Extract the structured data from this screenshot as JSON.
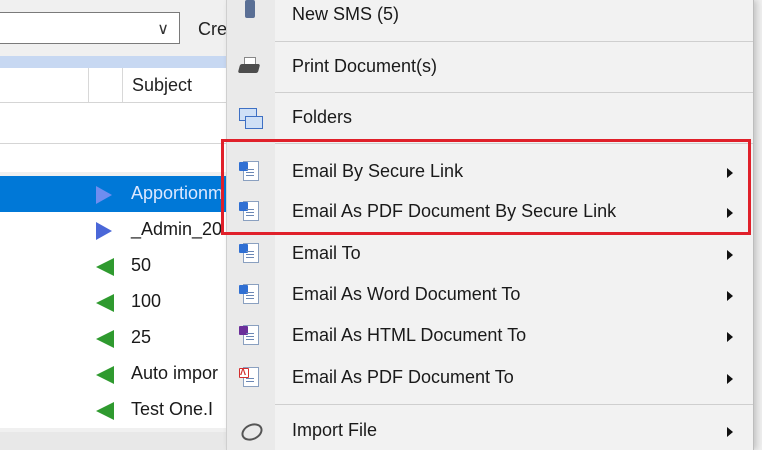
{
  "background": {
    "toolbar": {
      "combo_value": "",
      "create_label": "Cre"
    },
    "column_header": {
      "subject": "Subject"
    },
    "rows": [
      {
        "text": "Apportionm",
        "icon": "triangle-right-blue",
        "selected": true
      },
      {
        "text": "_Admin_20",
        "icon": "triangle-right-blue",
        "selected": false
      },
      {
        "text": "50",
        "icon": "triangle-left-green",
        "selected": false
      },
      {
        "text": "100",
        "icon": "triangle-left-green",
        "selected": false
      },
      {
        "text": "25",
        "icon": "triangle-left-green",
        "selected": false
      },
      {
        "text": "Auto impor",
        "icon": "triangle-left-green",
        "selected": false
      },
      {
        "text": "Test One.I",
        "icon": "triangle-left-green",
        "selected": false
      }
    ]
  },
  "menu": {
    "items": [
      {
        "label": "New SMS (5)",
        "icon": "phone-icon",
        "submenu": false
      },
      {
        "label": "Print Document(s)",
        "icon": "printer-icon",
        "submenu": false
      },
      {
        "label": "Folders",
        "icon": "folders-icon",
        "submenu": false
      },
      {
        "label": "Email By Secure Link",
        "icon": "word-doc-icon",
        "submenu": true
      },
      {
        "label": "Email As PDF Document By Secure Link",
        "icon": "word-doc-icon",
        "submenu": true
      },
      {
        "label": "Email To",
        "icon": "word-doc-icon",
        "submenu": true
      },
      {
        "label": "Email As Word Document To",
        "icon": "word-doc-icon",
        "submenu": true
      },
      {
        "label": "Email As HTML Document To",
        "icon": "html-doc-icon",
        "submenu": true
      },
      {
        "label": "Email As PDF Document To",
        "icon": "pdf-doc-icon",
        "submenu": true
      },
      {
        "label": "Import File",
        "icon": "import-disc-icon",
        "submenu": true
      }
    ]
  },
  "colors": {
    "selection": "#0078d7",
    "highlight": "#e0202a",
    "blue_triangle": "#4a67d8",
    "green_triangle": "#2f9a2f"
  }
}
